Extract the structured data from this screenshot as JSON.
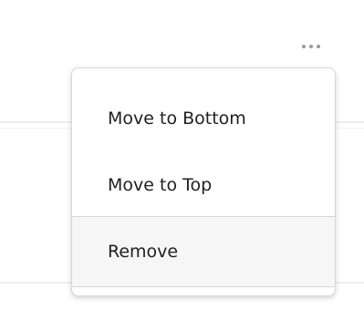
{
  "icons": {
    "more": "more-horizontal-icon"
  },
  "menu": {
    "items": [
      {
        "label": "Move to Bottom"
      },
      {
        "label": "Move to Top"
      },
      {
        "label": "Remove",
        "state": "hovered"
      }
    ]
  },
  "colors": {
    "hover_background": "#f6f6f6",
    "text": "#1f1f1f",
    "border": "#d8d8d8",
    "icon": "#9a9a9a"
  }
}
